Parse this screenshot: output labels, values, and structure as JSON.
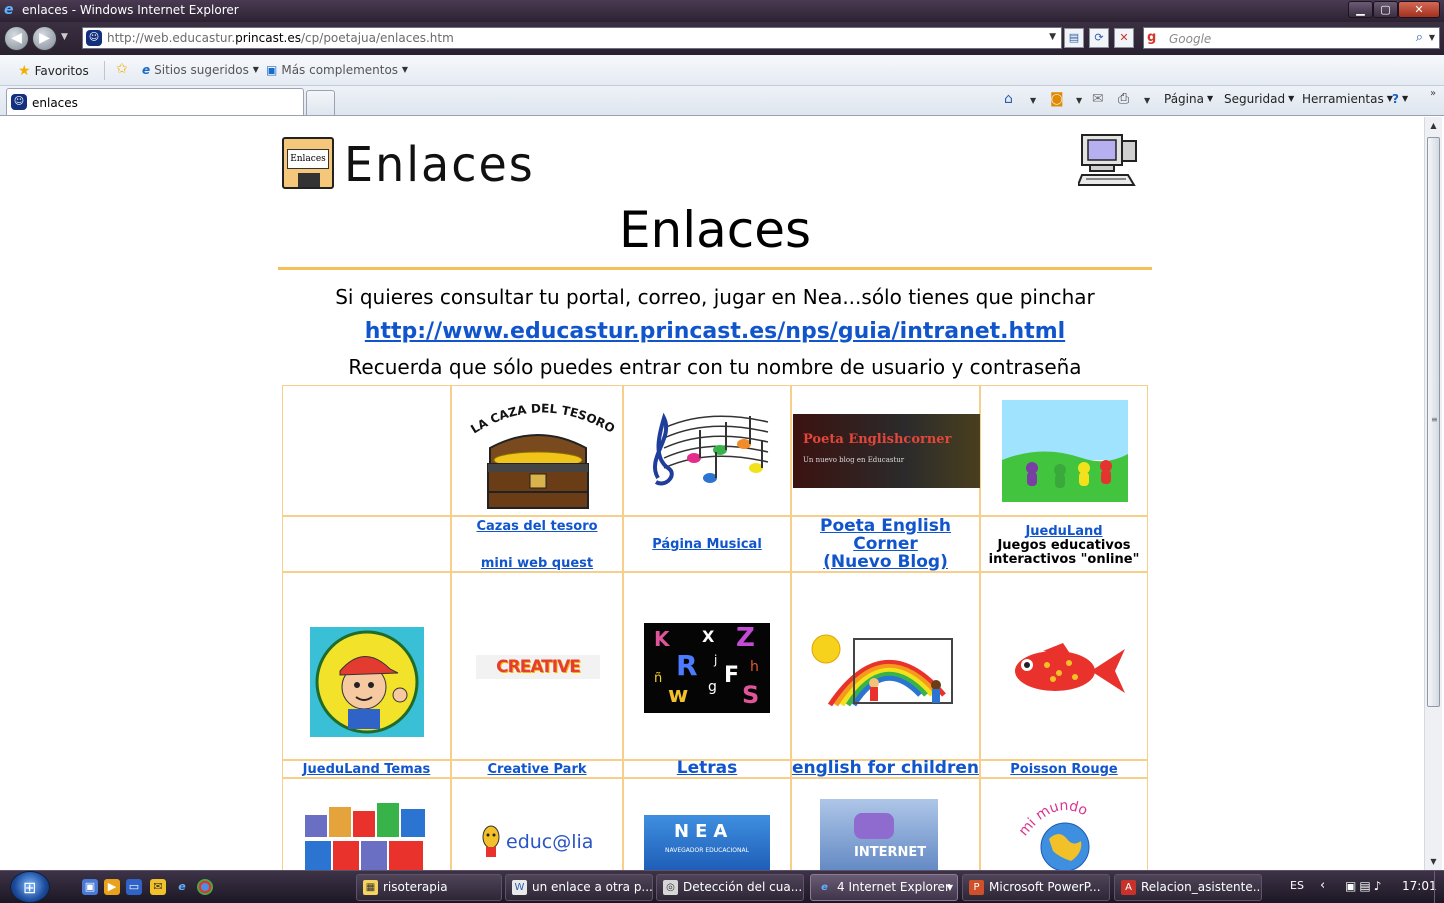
{
  "window": {
    "title": "enlaces - Windows Internet Explorer",
    "minimize": "▁",
    "maximize": "▢",
    "close": "✕"
  },
  "address_bar": {
    "url_prefix": "http://web.educastur.",
    "url_domain": "princast.es",
    "url_path": "/cp/poetajua/enlaces.htm",
    "search_placeholder": "Google"
  },
  "favorites_bar": {
    "favorites_label": "Favoritos",
    "suggested_label": "Sitios sugeridos",
    "addons_label": "Más complementos"
  },
  "tabs": [
    {
      "label": "enlaces",
      "active": true
    }
  ],
  "command_bar": {
    "page": "Página",
    "safety": "Seguridad",
    "tools": "Herramientas"
  },
  "page": {
    "logo_label": "Enlaces",
    "logo_text": "Enlaces",
    "title": "Enlaces",
    "intro": "Si quieres consultar tu portal, correo, jugar en Nea...sólo tienes que pinchar",
    "intro_link": "http://www.educastur.princast.es/nps/guia/intranet.html",
    "note": "Recuerda que sólo puedes entrar con tu nombre de usuario y contraseña",
    "row1": [
      {
        "image": "",
        "label": ""
      },
      {
        "image": "LA CAZA DEL TESORO",
        "label": "Cazas del tesoro",
        "label2": "mini web quest"
      },
      {
        "image": "",
        "label": "Página Musical"
      },
      {
        "image": "Poeta Englishcorner",
        "image_sub": "Un nuevo blog en Educastur",
        "label_lines": [
          "Poeta English",
          "Corner",
          "(Nuevo Blog)"
        ]
      },
      {
        "image": "",
        "label": "JueduLand",
        "desc_lines": [
          "Juegos educativos",
          "interactivos \"online\""
        ]
      }
    ],
    "row2": [
      {
        "image": "",
        "label": "JueduLand Temas"
      },
      {
        "image": "CREATIVE PARK",
        "label": "Creative Park"
      },
      {
        "image": [
          "K",
          "X",
          "Z",
          "R",
          "j",
          "F",
          "h",
          "ñ",
          "g",
          "w",
          "S"
        ],
        "label": "Letras"
      },
      {
        "image": "",
        "label": "english for children"
      },
      {
        "image": "",
        "label": "Poisson Rouge"
      }
    ],
    "row3": [
      {
        "image": ""
      },
      {
        "image": "educ@lia"
      },
      {
        "image": "NEA",
        "image_sub": "NAVEGADOR EDUCACIONAL"
      },
      {
        "image": "INTERNET"
      },
      {
        "image": "mi mundo"
      }
    ]
  },
  "taskbar": {
    "tasks": [
      {
        "label": "risoterapia",
        "icon_color": "#f4d35e"
      },
      {
        "label": "un enlace a otra p...",
        "icon_color": "#e9e9e9"
      },
      {
        "label": "Detección del cua...",
        "icon_color": "#d6d6d6"
      },
      {
        "label": "4 Internet Explorer",
        "icon_color": "#3f8fe0",
        "active": true
      },
      {
        "label": "Microsoft PowerP...",
        "icon_color": "#d0502a"
      },
      {
        "label": "Relacion_asistente...",
        "icon_color": "#c8322b"
      }
    ],
    "language": "ES",
    "clock": "17:01"
  }
}
